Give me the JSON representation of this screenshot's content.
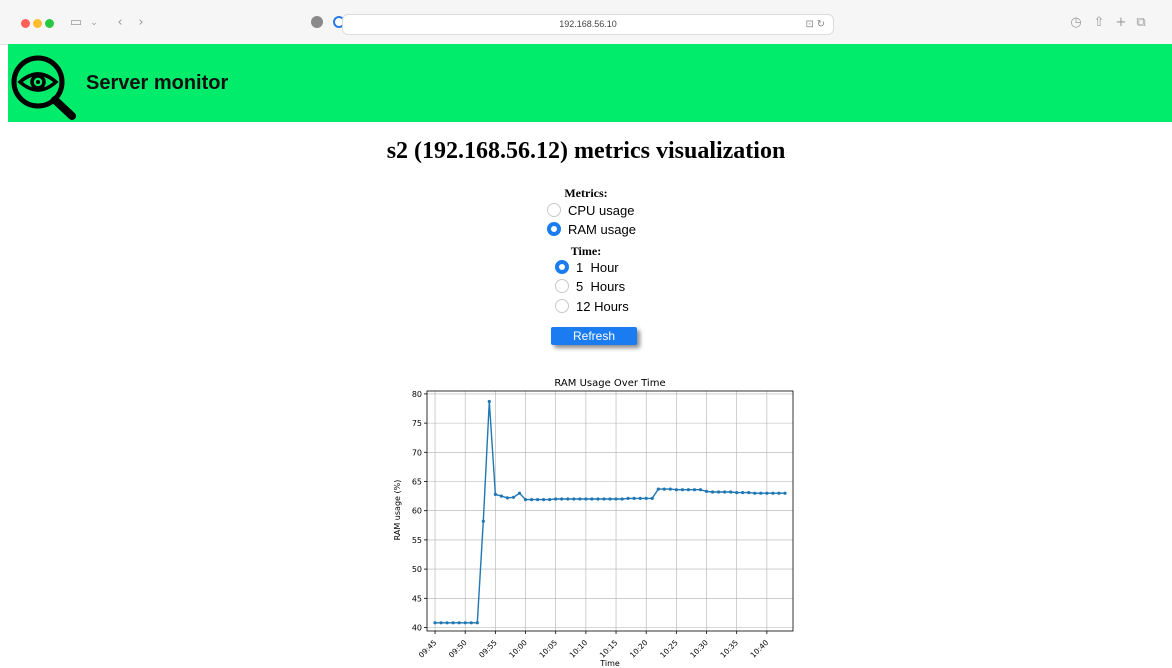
{
  "browser": {
    "url": "192.168.56.10",
    "icons": [
      "sidebar-icon",
      "chevron-down-icon",
      "back-icon",
      "forward-icon",
      "shield-icon",
      "extension-icon",
      "translate-icon",
      "reload-icon",
      "history-icon",
      "share-icon",
      "new-tab-icon",
      "tabs-overview-icon"
    ]
  },
  "header": {
    "title": "Server monitor",
    "logo_icon": "eye-magnifier-icon",
    "background": "#00ec6a"
  },
  "page": {
    "title": "s2 (192.168.56.12) metrics visualization"
  },
  "form": {
    "metrics_legend": "Metrics:",
    "metrics_options": [
      {
        "label": "CPU usage",
        "checked": false
      },
      {
        "label": "RAM usage",
        "checked": true
      }
    ],
    "time_legend": "Time:",
    "time_options": [
      {
        "label": "1  Hour",
        "checked": true
      },
      {
        "label": "5  Hours",
        "checked": false
      },
      {
        "label": "12 Hours",
        "checked": false
      }
    ],
    "refresh_label": "Refresh",
    "accent": "#1a7cf0"
  },
  "chart_data": {
    "type": "line",
    "title": "RAM Usage Over Time",
    "xlabel": "Time",
    "ylabel": "RAM usage (%)",
    "ylim": [
      39.4,
      80.5
    ],
    "xlim": [
      "09:43:40",
      "10:44:20"
    ],
    "grid": true,
    "x_ticks": [
      "09:45",
      "09:50",
      "09:55",
      "10:00",
      "10:05",
      "10:10",
      "10:15",
      "10:20",
      "10:25",
      "10:30",
      "10:35",
      "10:40"
    ],
    "y_ticks": [
      40,
      45,
      50,
      55,
      60,
      65,
      70,
      75,
      80
    ],
    "color": "#1f77b4",
    "series": [
      {
        "x": [
          "09:45",
          "09:46",
          "09:47",
          "09:48",
          "09:49",
          "09:50",
          "09:51",
          "09:52",
          "09:53",
          "09:54",
          "09:55",
          "09:56",
          "09:57",
          "09:58",
          "09:59",
          "10:00",
          "10:01",
          "10:02",
          "10:03",
          "10:04",
          "10:05",
          "10:06",
          "10:07",
          "10:08",
          "10:09",
          "10:10",
          "10:11",
          "10:12",
          "10:13",
          "10:14",
          "10:15",
          "10:16",
          "10:17",
          "10:18",
          "10:19",
          "10:20",
          "10:21",
          "10:22",
          "10:23",
          "10:24",
          "10:25",
          "10:26",
          "10:27",
          "10:28",
          "10:29",
          "10:30",
          "10:31",
          "10:32",
          "10:33",
          "10:34",
          "10:35",
          "10:36",
          "10:37",
          "10:38",
          "10:39",
          "10:40",
          "10:41",
          "10:42",
          "10:43"
        ],
        "y": [
          40.8,
          40.8,
          40.8,
          40.8,
          40.8,
          40.8,
          40.8,
          40.8,
          58.2,
          78.7,
          62.8,
          62.5,
          62.2,
          62.3,
          63.0,
          61.9,
          61.9,
          61.9,
          61.9,
          61.9,
          62.0,
          62.0,
          62.0,
          62.0,
          62.0,
          62.0,
          62.0,
          62.0,
          62.0,
          62.0,
          62.0,
          62.0,
          62.1,
          62.1,
          62.1,
          62.1,
          62.1,
          63.7,
          63.7,
          63.7,
          63.6,
          63.6,
          63.6,
          63.6,
          63.6,
          63.3,
          63.2,
          63.2,
          63.2,
          63.2,
          63.1,
          63.1,
          63.1,
          63.0,
          63.0,
          63.0,
          63.0,
          63.0,
          63.0
        ]
      }
    ]
  }
}
